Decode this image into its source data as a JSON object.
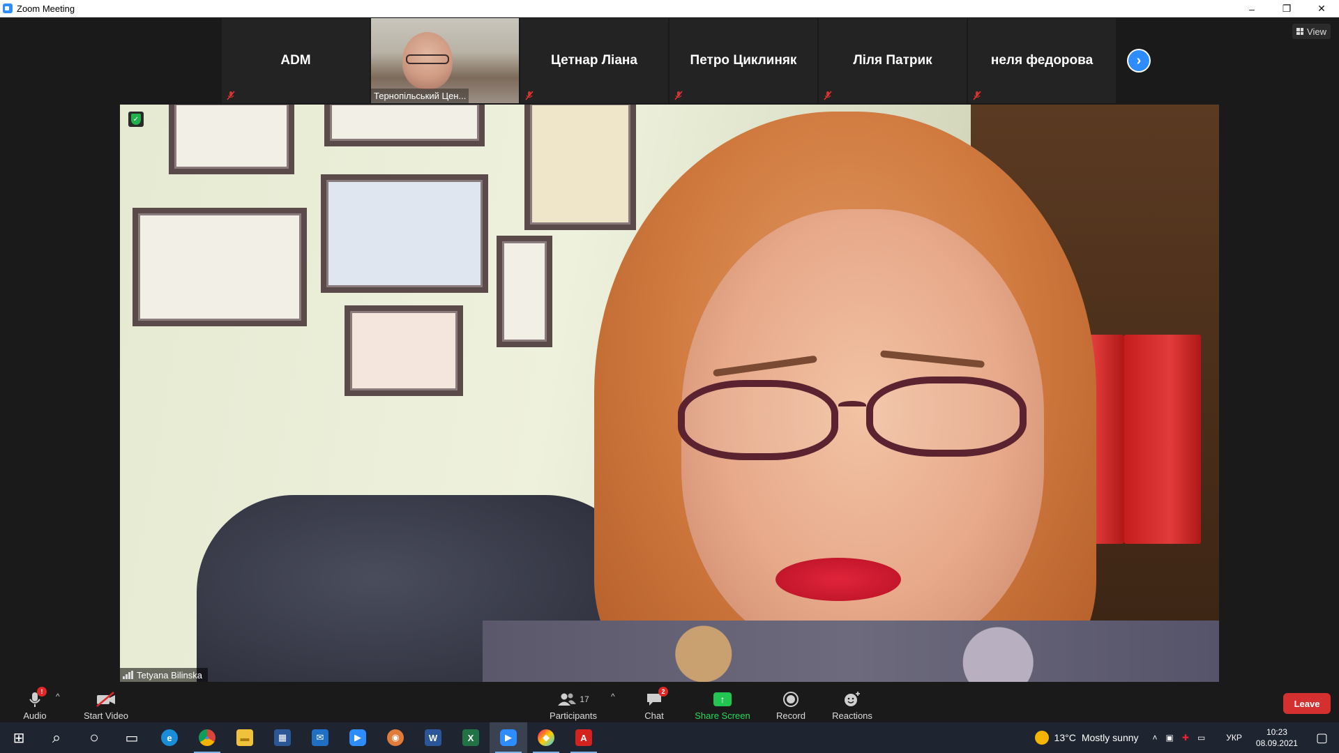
{
  "window": {
    "title": "Zoom Meeting",
    "minimize": "–",
    "restore": "❐",
    "close": "✕"
  },
  "view_button": {
    "label": "View"
  },
  "thumbnails": [
    {
      "name": "ADM",
      "muted": true,
      "video": false
    },
    {
      "name": "Тернопільський Цен...",
      "muted": false,
      "video": true
    },
    {
      "name": "Цетнар Ліана",
      "muted": true,
      "video": false
    },
    {
      "name": "Петро Циклиняк",
      "muted": true,
      "video": false
    },
    {
      "name": "Ліля Патрик",
      "muted": true,
      "video": false
    },
    {
      "name": "неля федорова",
      "muted": true,
      "video": false
    }
  ],
  "next_page_glyph": "›",
  "speaker": {
    "name": "Tetyana Bilinska",
    "shield_glyph": "✓"
  },
  "controls": {
    "audio": {
      "label": "Audio",
      "badge": "!"
    },
    "video": {
      "label": "Start Video"
    },
    "participants": {
      "label": "Participants",
      "count": "17"
    },
    "chat": {
      "label": "Chat",
      "badge": "2"
    },
    "share": {
      "label": "Share Screen",
      "glyph": "↑"
    },
    "record": {
      "label": "Record"
    },
    "reactions": {
      "label": "Reactions"
    },
    "leave": {
      "label": "Leave"
    },
    "caret": "^"
  },
  "taskbar": {
    "apps": [
      {
        "name": "start-icon",
        "glyph": "⊞",
        "color": "#1f2530"
      },
      {
        "name": "search-icon",
        "glyph": "⌕",
        "color": "#1f2530"
      },
      {
        "name": "cortana-icon",
        "glyph": "○",
        "color": "#1f2530"
      },
      {
        "name": "task-view-icon",
        "glyph": "▭",
        "color": "#1f2530"
      },
      {
        "name": "edge-icon",
        "glyph": "e",
        "color": "#1a8dd8"
      },
      {
        "name": "chrome-icon",
        "glyph": "●",
        "color": "#db4437"
      },
      {
        "name": "file-explorer-icon",
        "glyph": "▬",
        "color": "#f0c23b"
      },
      {
        "name": "store-icon",
        "glyph": "▦",
        "color": "#2b5797"
      },
      {
        "name": "mail-icon",
        "glyph": "✉",
        "color": "#1f6fc5"
      },
      {
        "name": "zoom-icon",
        "glyph": "▶",
        "color": "#2d8cff"
      },
      {
        "name": "browser-icon",
        "glyph": "◉",
        "color": "#e07b39"
      },
      {
        "name": "word-icon",
        "glyph": "W",
        "color": "#2b579a"
      },
      {
        "name": "excel-icon",
        "glyph": "X",
        "color": "#217346"
      },
      {
        "name": "zoom-active-icon",
        "glyph": "▶",
        "color": "#2d8cff"
      },
      {
        "name": "paint-icon",
        "glyph": "◆",
        "color": "#c43aa0"
      },
      {
        "name": "acrobat-icon",
        "glyph": "A",
        "color": "#d4231f"
      }
    ],
    "weather": {
      "temp": "13°C",
      "desc": "Mostly sunny"
    },
    "language": "УКР",
    "time": "10:23",
    "date": "08.09.2021"
  }
}
